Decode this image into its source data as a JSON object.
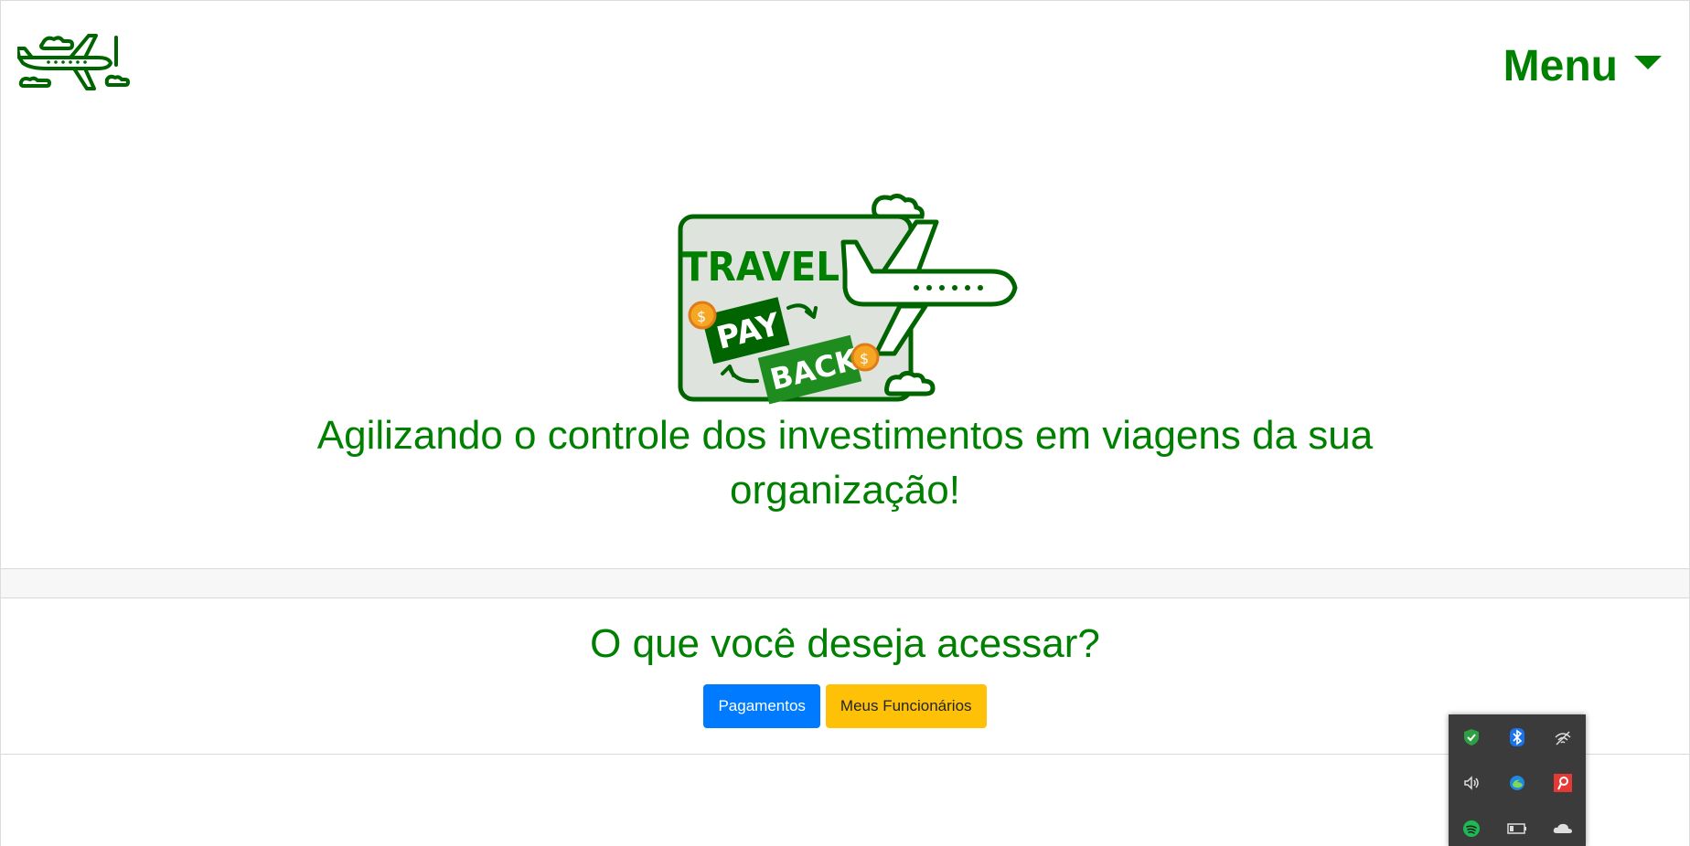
{
  "nav": {
    "logo_icon": "airplane-logo-icon",
    "menu_label": "Menu",
    "menu_caret_icon": "caret-down-icon"
  },
  "hero": {
    "logo_text_top": "TRAVEL",
    "logo_text_pay": "PAY",
    "logo_text_back": "BACK",
    "tagline": "Agilizando o controle dos investimentos em viagens da sua organização!"
  },
  "access": {
    "title": "O que você deseja acessar?",
    "buttons": [
      {
        "label": "Pagamentos",
        "color": "#007bff"
      },
      {
        "label": "Meus Funcionários",
        "color": "#ffc107"
      }
    ]
  },
  "colors": {
    "brand_green": "#008000",
    "dark_green": "#006400",
    "logo_card": "#dfe3dd",
    "coin": "#f5a623"
  },
  "system_tray": {
    "icons": [
      "windows-security-icon",
      "bluetooth-icon",
      "network-icon",
      "volume-icon",
      "edge-icon",
      "app-icon",
      "spotify-icon",
      "battery-icon",
      "onedrive-icon"
    ]
  }
}
